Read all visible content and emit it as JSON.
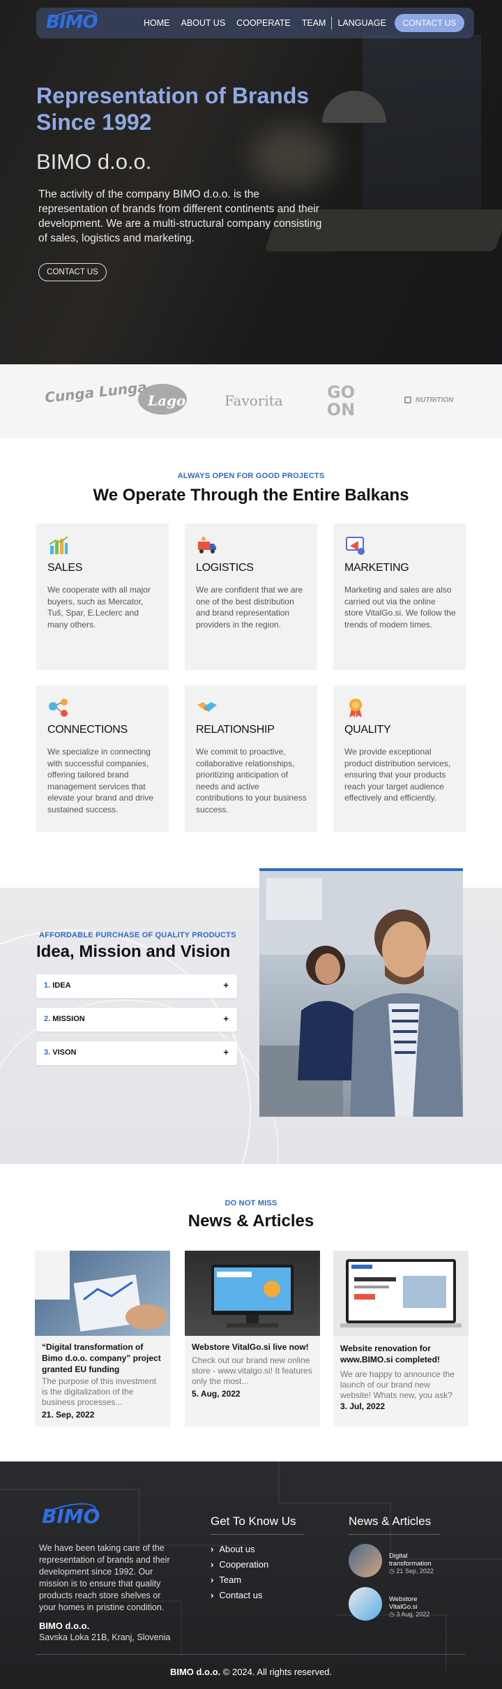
{
  "nav": {
    "logo": "BIMO",
    "items": [
      "HOME",
      "ABOUT US",
      "COOPERATE",
      "TEAM",
      "LANGUAGE"
    ],
    "cta": "CONTACT US"
  },
  "hero": {
    "title": "Representation of Brands Since 1992",
    "subtitle": "BIMO d.o.o.",
    "lead": "The activity of the company BIMO d.o.o. is the representation of brands from different continents and their development. We are a multi-structural company consisting of sales, logistics and marketing.",
    "button": "CONTACT US"
  },
  "brands": [
    "Cunga Lunga",
    "Lago",
    "Favorita",
    "GO ON",
    "NUTRITION"
  ],
  "operate": {
    "eyebrow": "ALWAYS OPEN FOR GOOD PROJECTS",
    "title": "We Operate Through the Entire Balkans",
    "cards": [
      {
        "title": "SALES",
        "text": "We cooperate with all major buyers, such as Mercator, Tuš, Spar, E.Leclerc and many others.",
        "icon": "bar-chart-icon"
      },
      {
        "title": "LOGISTICS",
        "text": "We are confident that we are one of the best distribution and brand representation providers in the region.",
        "icon": "truck-icon"
      },
      {
        "title": "MARKETING",
        "text": "Marketing and sales are also carried out via the online store VitalGo.si. We follow the trends of modern times.",
        "icon": "megaphone-icon"
      },
      {
        "title": "CONNECTIONS",
        "text": "We specialize in connecting with successful companies, offering tailored brand management services that elevate your brand and drive sustained success.",
        "icon": "network-icon"
      },
      {
        "title": "RELATIONSHIP",
        "text": "We commit to proactive, collaborative relationships, prioritizing anticipation of needs and active contributions to your business success.",
        "icon": "handshake-icon"
      },
      {
        "title": "QUALITY",
        "text": "We provide exceptional product distribution services, ensuring that your products reach your target audience effectively and efficiently.",
        "icon": "award-icon"
      }
    ]
  },
  "mission": {
    "eyebrow": "AFFORDABLE PURCHASE OF QUALITY PRODUCTS",
    "title": "Idea, Mission and Vision",
    "items": [
      {
        "num": "1.",
        "label": "IDEA"
      },
      {
        "num": "2.",
        "label": "MISSION"
      },
      {
        "num": "3.",
        "label": "VISON"
      }
    ],
    "plus": "+"
  },
  "news": {
    "eyebrow": "DO NOT MISS",
    "title": "News & Articles",
    "articles": [
      {
        "title": "“Digital transformation of Bimo d.o.o. company” project granted EU funding",
        "excerpt": "The purpose of this investment is the digitalization of the business processes...",
        "date": "21. Sep, 2022"
      },
      {
        "title": "Webstore VitalGo.si live now!",
        "excerpt": "Check out our brand new online store - www.vitalgo.si! It features only the most...",
        "date": "5. Aug, 2022"
      },
      {
        "title": "Website renovation for www.BIMO.si completed!",
        "excerpt": "We are happy to announce the launch of our brand new website! Whats new, you ask?",
        "date": "3. Jul, 2022"
      }
    ]
  },
  "footer": {
    "logo": "BIMO",
    "about": "We have been taking care of the representation of brands and their development since 1992. Our mission is to ensure that quality products reach store shelves or your homes in pristine condition.",
    "company": "BIMO d.o.o.",
    "address": "Savska Loka 21B, Kranj, Slovenia",
    "links_title": "Get To Know Us",
    "links": [
      "About us",
      "Cooperation",
      "Team",
      "Contact us"
    ],
    "news_title": "News & Articles",
    "news": [
      {
        "title": "Digital transformation",
        "date": "21 Sep, 2022"
      },
      {
        "title": "Webstore VitalGo.si",
        "date": "3 Aug, 2022"
      }
    ],
    "copyright_brand": "BIMO d.o.o.",
    "copyright": "© 2024. All rights reserved."
  },
  "colors": {
    "accent": "#2f6ac9",
    "nav_button": "#8ea9e6"
  }
}
